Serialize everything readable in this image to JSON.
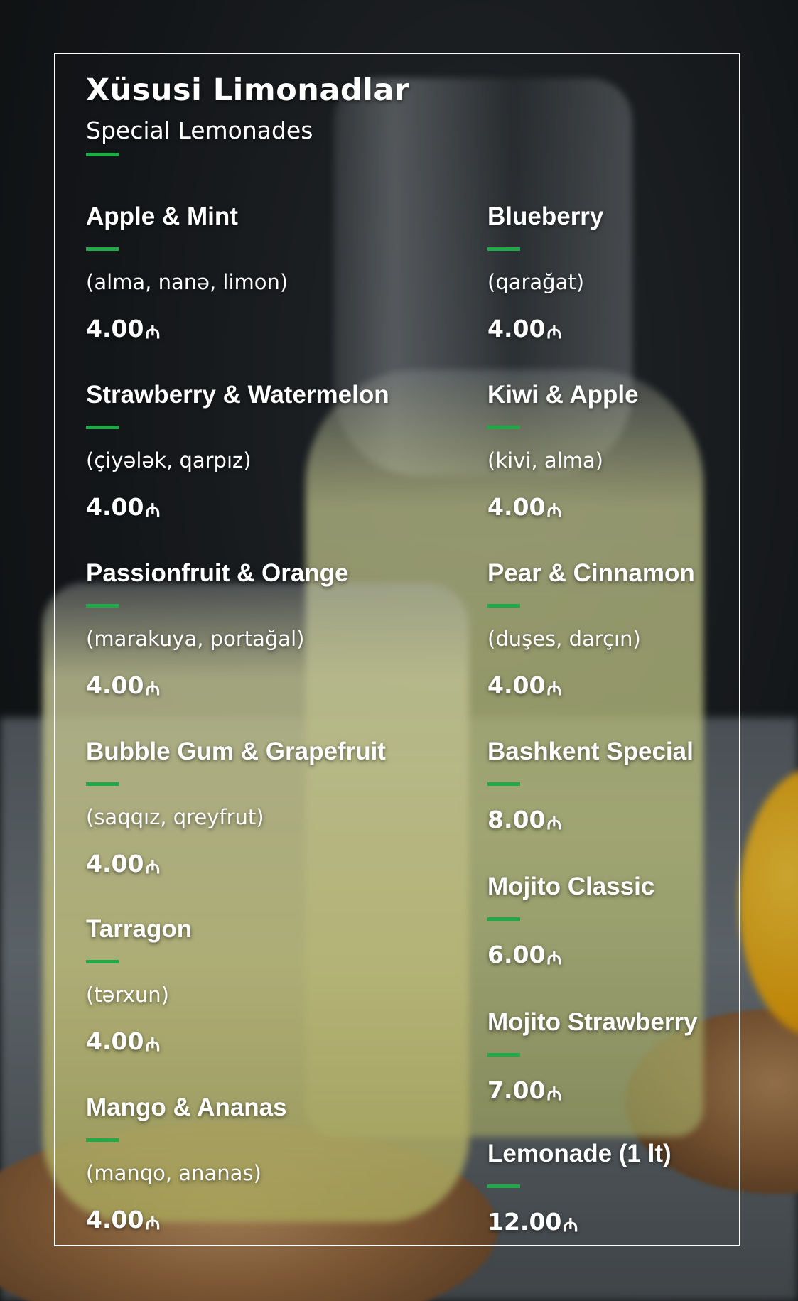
{
  "header": {
    "title": "Xüsusi Limonadlar",
    "subtitle": "Special Lemonades"
  },
  "currency_icon": "manat-icon",
  "accent_color": "#1faa4a",
  "items": [
    {
      "name": "Apple & Mint",
      "ingredients": "(alma, nanə, limon)",
      "price": "4.00"
    },
    {
      "name": "Strawberry & Watermelon",
      "ingredients": "(çiyələk, qarpız)",
      "price": "4.00"
    },
    {
      "name": "Passionfruit & Orange",
      "ingredients": "(marakuya, portağal)",
      "price": "4.00"
    },
    {
      "name": "Bubble Gum & Grapefruit",
      "ingredients": "(saqqız, qreyfrut)",
      "price": "4.00"
    },
    {
      "name": "Tarragon",
      "ingredients": "(tərxun)",
      "price": "4.00"
    },
    {
      "name": "Mango & Ananas",
      "ingredients": "(manqo, ananas)",
      "price": "4.00"
    },
    {
      "name": "Blueberry",
      "ingredients": "(qarağat)",
      "price": "4.00"
    },
    {
      "name": "Kiwi & Apple",
      "ingredients": "(kivi, alma)",
      "price": "4.00"
    },
    {
      "name": "Pear & Cinnamon",
      "ingredients": "(duşes, darçın)",
      "price": "4.00"
    },
    {
      "name": "Bashkent Special",
      "price": "8.00"
    },
    {
      "name": "Mojito Classic",
      "price": "6.00"
    },
    {
      "name": "Mojito Strawberry",
      "price": "7.00"
    },
    {
      "name": "Lemonade (1 lt)",
      "price": "12.00"
    }
  ]
}
